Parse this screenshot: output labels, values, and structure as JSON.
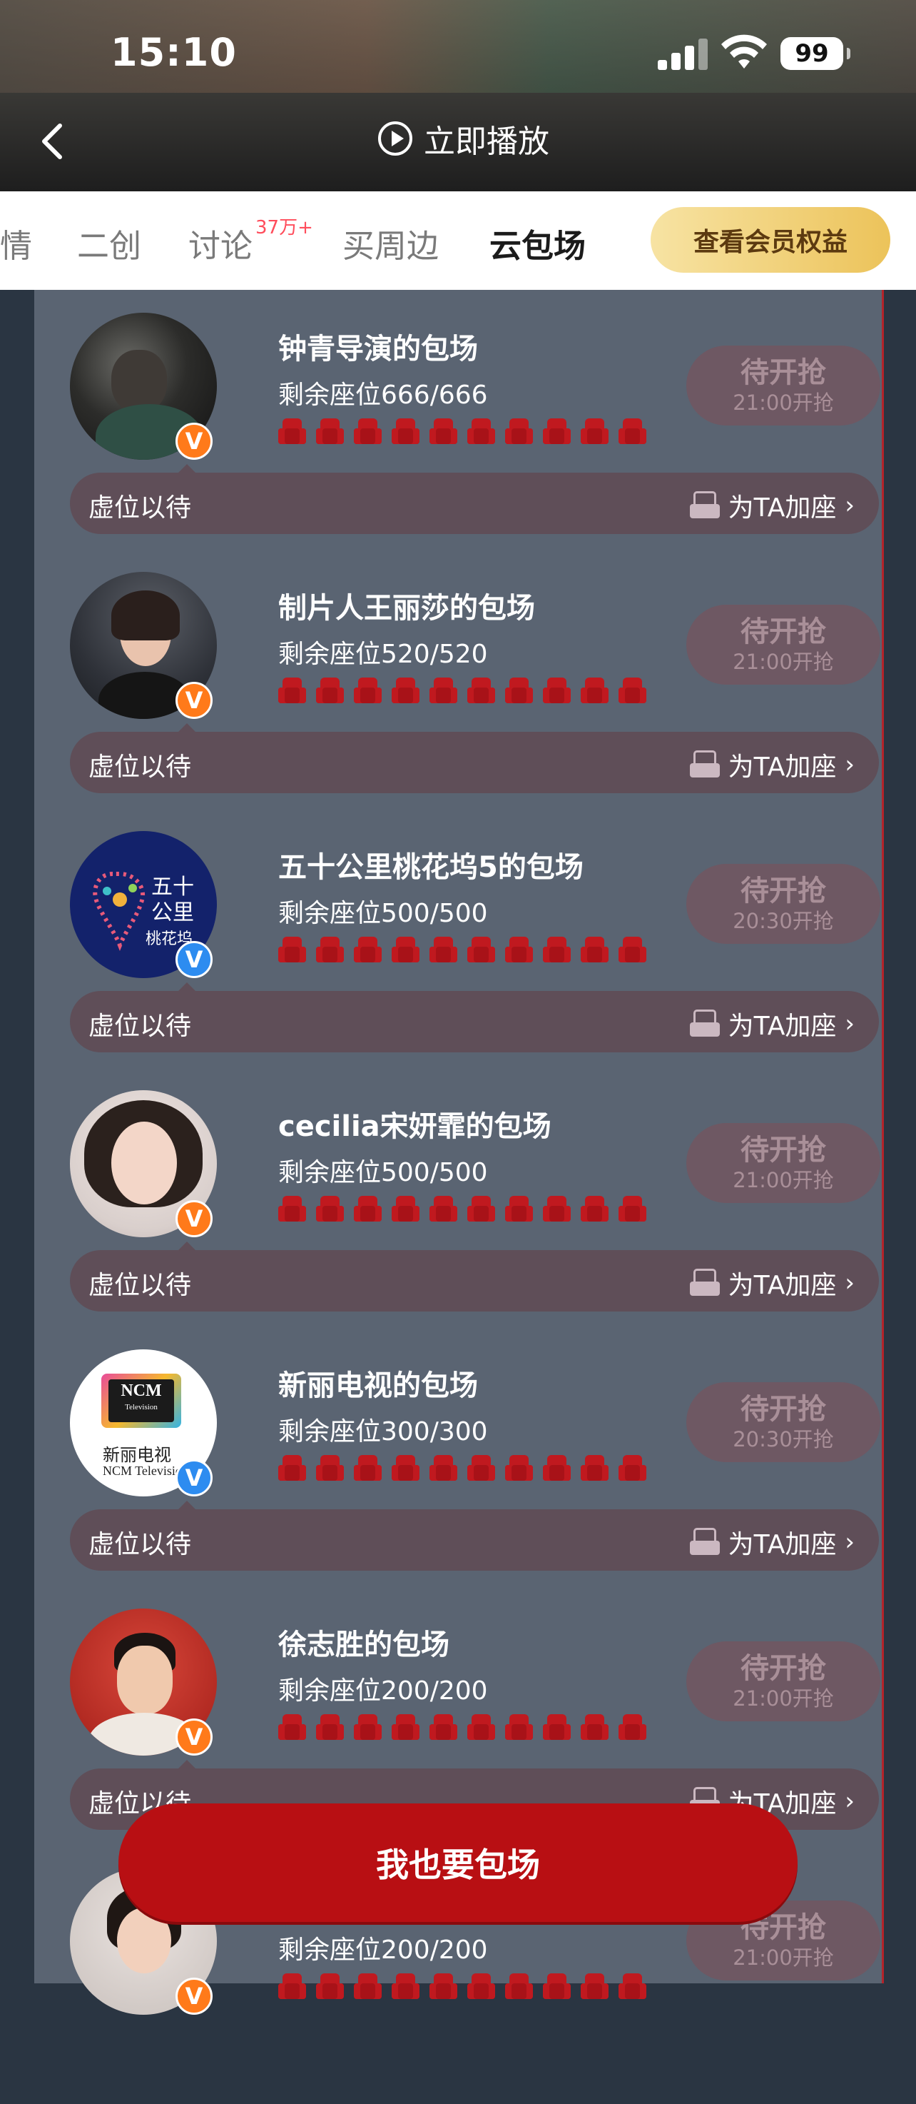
{
  "status_bar": {
    "time": "15:10",
    "battery": "99"
  },
  "header": {
    "play_label": "立即播放"
  },
  "tabs": {
    "items": [
      {
        "label": "情"
      },
      {
        "label": "二创"
      },
      {
        "label": "讨论"
      },
      {
        "label": "买周边"
      },
      {
        "label": "云包场"
      }
    ],
    "active": "云包场",
    "discussion_badge": "37万+",
    "member_button": "查看会员权益"
  },
  "cards": [
    {
      "title": "钟青导演的包场",
      "seats": "剩余座位666/666",
      "grab": "待开抢",
      "time": "21:00开抢",
      "badge": "orange"
    },
    {
      "title": "制片人王丽莎的包场",
      "seats": "剩余座位520/520",
      "grab": "待开抢",
      "time": "21:00开抢",
      "badge": "orange"
    },
    {
      "title": "五十公里桃花坞5的包场",
      "seats": "剩余座位500/500",
      "grab": "待开抢",
      "time": "20:30开抢",
      "badge": "blue"
    },
    {
      "title": "cecilia宋妍霏的包场",
      "seats": "剩余座位500/500",
      "grab": "待开抢",
      "time": "21:00开抢",
      "badge": "orange"
    },
    {
      "title": "新丽电视的包场",
      "seats": "剩余座位300/300",
      "grab": "待开抢",
      "time": "20:30开抢",
      "badge": "blue"
    },
    {
      "title": "徐志胜的包场",
      "seats": "剩余座位200/200",
      "grab": "待开抢",
      "time": "21:00开抢",
      "badge": "orange"
    },
    {
      "title": "",
      "seats": "剩余座位200/200",
      "grab": "待开抢",
      "time": "21:00开抢",
      "badge": "orange"
    }
  ],
  "row_bar": {
    "left": "虚位以待",
    "right": "为TA加座"
  },
  "avatar_logos": {
    "taohuawu": [
      "五十",
      "公里",
      "桃花坞"
    ],
    "ncm": [
      "NCM",
      "Television",
      "新丽电视",
      "NCM Television"
    ]
  },
  "cta": {
    "label": "我也要包场"
  },
  "colors": {
    "panel_bg": "#5a6472",
    "bar_bg": "#5f4e58",
    "grab_bg": "#6e5863",
    "seat_red": "#c0191f",
    "cta_red": "#b80f13",
    "member_gold": "#ecc35a",
    "badge_pink": "#ff4d5c"
  }
}
